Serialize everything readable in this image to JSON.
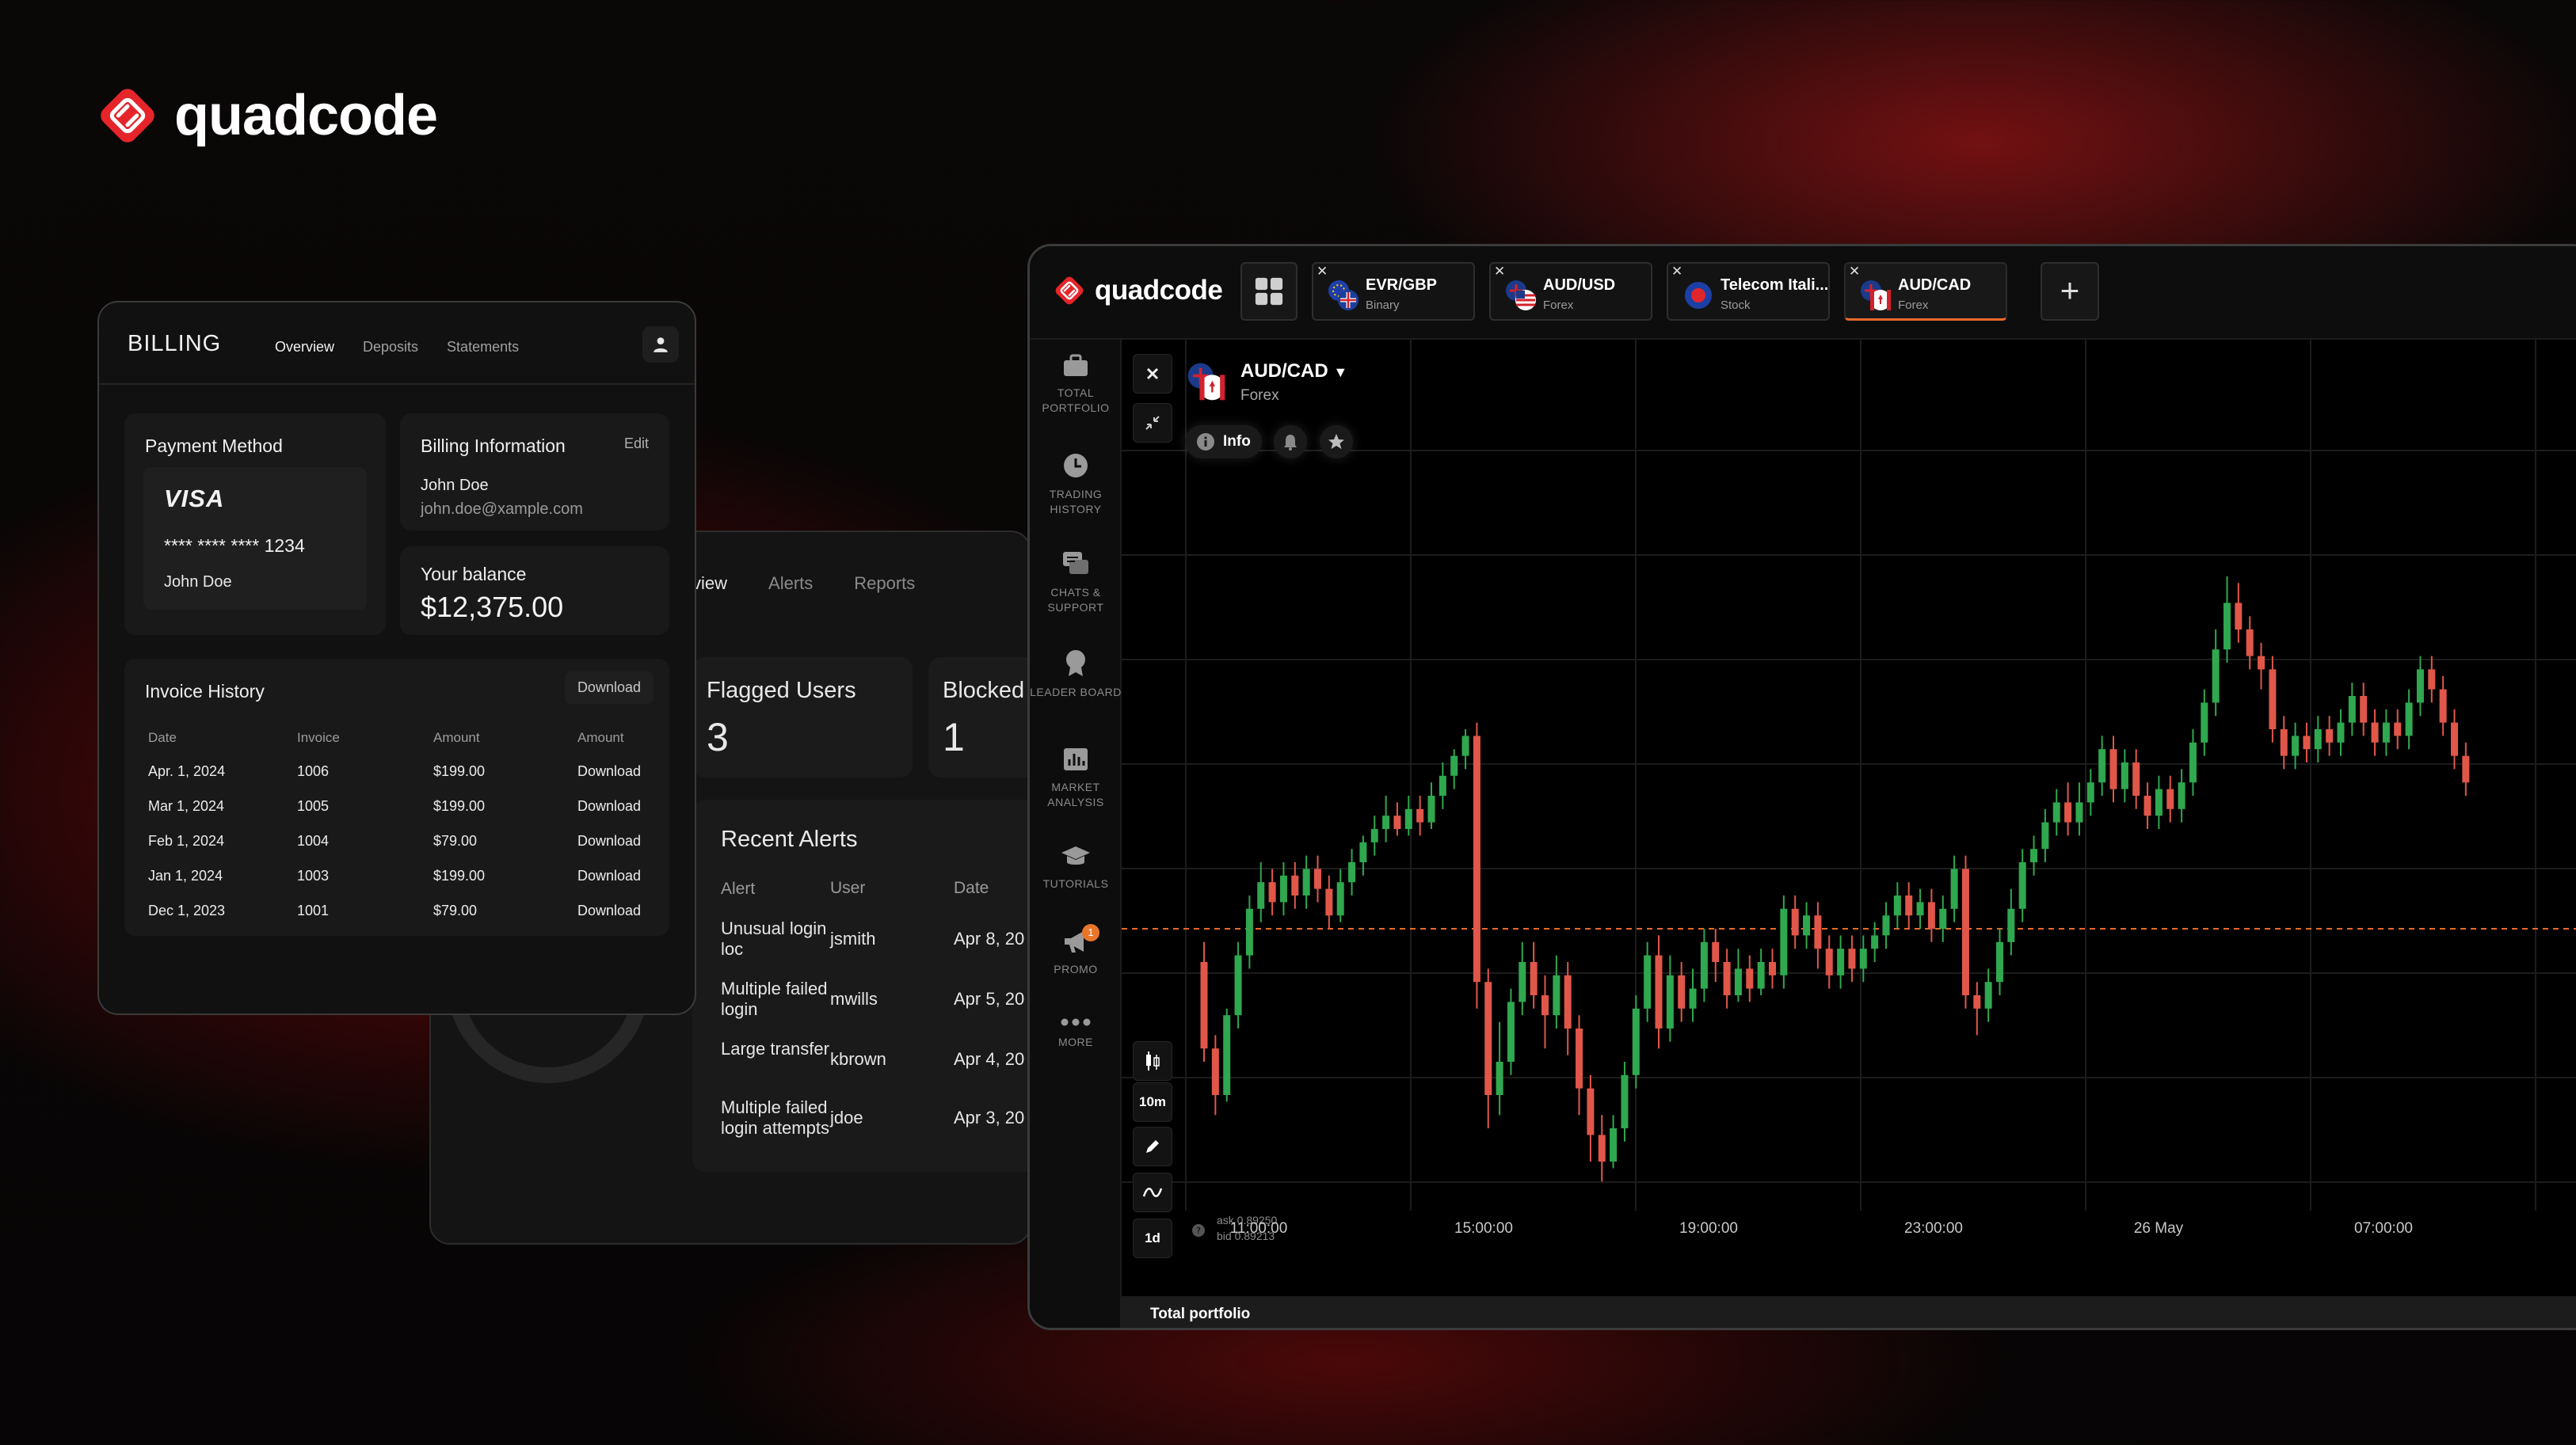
{
  "brand": {
    "name": "quadcode",
    "logo_icon": "quadcode-logo-icon"
  },
  "billing": {
    "title": "BILLING",
    "tabs": [
      "Overview",
      "Deposits",
      "Statements"
    ],
    "payment_method": {
      "title": "Payment Method",
      "card_brand": "VISA",
      "card_number": "**** **** **** 1234",
      "card_holder": "John Doe"
    },
    "billing_info": {
      "title": "Billing Information",
      "edit_label": "Edit",
      "name": "John Doe",
      "email": "john.doe@xample.com"
    },
    "balance": {
      "title": "Your balance",
      "value": "$12,375.00"
    },
    "invoice_history": {
      "title": "Invoice History",
      "download_label": "Download",
      "columns": [
        "Date",
        "Invoice",
        "Amount",
        "Amount"
      ],
      "rows": [
        {
          "date": "Apr. 1, 2024",
          "invoice": "1006",
          "amount": "$199.00",
          "action": "Download"
        },
        {
          "date": "Mar 1, 2024",
          "invoice": "1005",
          "amount": "$199.00",
          "action": "Download"
        },
        {
          "date": "Feb 1, 2024",
          "invoice": "1004",
          "amount": "$79.00",
          "action": "Download"
        },
        {
          "date": "Jan 1, 2024",
          "invoice": "1003",
          "amount": "$199.00",
          "action": "Download"
        },
        {
          "date": "Dec 1, 2023",
          "invoice": "1001",
          "amount": "$79.00",
          "action": "Download"
        }
      ]
    }
  },
  "alerts_panel": {
    "tabs": [
      "view",
      "Alerts",
      "Reports"
    ],
    "flagged": {
      "label": "Flagged Users",
      "value": "3"
    },
    "blocked": {
      "label": "Blocked",
      "value": "1"
    },
    "recent_alerts": {
      "title": "Recent Alerts",
      "columns": [
        "Alert",
        "User",
        "Date"
      ],
      "rows": [
        {
          "alert": "Unusual login loc",
          "user": "jsmith",
          "date": "Apr 8, 20"
        },
        {
          "alert": "Multiple failed login",
          "user": "mwills",
          "date": "Apr 5, 20"
        },
        {
          "alert": "Large transfer",
          "user": "kbrown",
          "date": "Apr 4, 20"
        },
        {
          "alert": "Multiple failed login attempts",
          "user": "jdoe",
          "date": "Apr 3, 20"
        }
      ]
    }
  },
  "trading": {
    "logo_text": "quadcode",
    "tabs": [
      {
        "name": "EVR/GBP",
        "type": "Binary",
        "flag": "eu-uk-flag",
        "active": false
      },
      {
        "name": "AUD/USD",
        "type": "Forex",
        "flag": "au-us-flag",
        "active": false
      },
      {
        "name": "Telecom Itali...",
        "type": "Stock",
        "flag": "telecom-logo",
        "active": false
      },
      {
        "name": "AUD/CAD",
        "type": "Forex",
        "flag": "au-ca-flag",
        "active": true
      }
    ],
    "sidebar": [
      {
        "label": "TOTAL PORTFOLIO",
        "icon": "briefcase-icon"
      },
      {
        "label": "TRADING HISTORY",
        "icon": "clock-icon"
      },
      {
        "label": "CHATS & SUPPORT",
        "icon": "chat-icon"
      },
      {
        "label": "LEADER BOARD",
        "icon": "medal-icon"
      },
      {
        "label": "MARKET ANALYSIS",
        "icon": "bar-chart-icon"
      },
      {
        "label": "TUTORIALS",
        "icon": "graduation-cap-icon"
      },
      {
        "label": "PROMO",
        "icon": "megaphone-icon",
        "badge": "1"
      },
      {
        "label": "MORE",
        "icon": "more-dots-icon"
      }
    ],
    "asset": {
      "name": "AUD/CAD",
      "type": "Forex"
    },
    "info_label": "Info",
    "timeframe": "10m",
    "period": "1d",
    "quote": {
      "ask": "ask 0.89250",
      "bid": "bid 0.89213"
    },
    "bottom_label": "Total portfolio",
    "colors": {
      "up": "#2fa84f",
      "down": "#e0574a",
      "accent": "#e86a2a"
    }
  },
  "chart_data": {
    "type": "candlestick",
    "x_labels": [
      "11:00:00",
      "15:00:00",
      "19:00:00",
      "23:00:00",
      "26 May",
      "07:00:00"
    ],
    "price_line_level": 0.4,
    "candles": [
      [
        0.35,
        0.22,
        0.38,
        0.2
      ],
      [
        0.22,
        0.15,
        0.24,
        0.12
      ],
      [
        0.15,
        0.27,
        0.28,
        0.14
      ],
      [
        0.27,
        0.36,
        0.38,
        0.25
      ],
      [
        0.36,
        0.43,
        0.45,
        0.34
      ],
      [
        0.43,
        0.47,
        0.5,
        0.41
      ],
      [
        0.47,
        0.44,
        0.49,
        0.42
      ],
      [
        0.44,
        0.48,
        0.5,
        0.42
      ],
      [
        0.48,
        0.45,
        0.5,
        0.43
      ],
      [
        0.45,
        0.49,
        0.51,
        0.43
      ],
      [
        0.49,
        0.46,
        0.51,
        0.44
      ],
      [
        0.46,
        0.42,
        0.48,
        0.4
      ],
      [
        0.42,
        0.47,
        0.49,
        0.41
      ],
      [
        0.47,
        0.5,
        0.52,
        0.45
      ],
      [
        0.5,
        0.53,
        0.54,
        0.48
      ],
      [
        0.53,
        0.55,
        0.57,
        0.51
      ],
      [
        0.55,
        0.57,
        0.6,
        0.53
      ],
      [
        0.57,
        0.55,
        0.59,
        0.54
      ],
      [
        0.55,
        0.58,
        0.6,
        0.54
      ],
      [
        0.58,
        0.56,
        0.6,
        0.54
      ],
      [
        0.56,
        0.6,
        0.62,
        0.55
      ],
      [
        0.6,
        0.63,
        0.65,
        0.58
      ],
      [
        0.63,
        0.66,
        0.67,
        0.61
      ],
      [
        0.66,
        0.69,
        0.7,
        0.64
      ],
      [
        0.69,
        0.32,
        0.71,
        0.28
      ],
      [
        0.32,
        0.15,
        0.34,
        0.1
      ],
      [
        0.15,
        0.2,
        0.26,
        0.12
      ],
      [
        0.2,
        0.29,
        0.31,
        0.18
      ],
      [
        0.29,
        0.35,
        0.38,
        0.27
      ],
      [
        0.35,
        0.3,
        0.38,
        0.28
      ],
      [
        0.3,
        0.27,
        0.33,
        0.22
      ],
      [
        0.27,
        0.33,
        0.36,
        0.25
      ],
      [
        0.33,
        0.25,
        0.35,
        0.21
      ],
      [
        0.25,
        0.16,
        0.27,
        0.12
      ],
      [
        0.16,
        0.09,
        0.18,
        0.05
      ],
      [
        0.09,
        0.05,
        0.12,
        0.02
      ],
      [
        0.05,
        0.1,
        0.12,
        0.04
      ],
      [
        0.1,
        0.18,
        0.2,
        0.08
      ],
      [
        0.18,
        0.28,
        0.3,
        0.16
      ],
      [
        0.28,
        0.36,
        0.38,
        0.26
      ],
      [
        0.36,
        0.25,
        0.39,
        0.22
      ],
      [
        0.25,
        0.33,
        0.36,
        0.23
      ],
      [
        0.33,
        0.28,
        0.35,
        0.26
      ],
      [
        0.28,
        0.31,
        0.34,
        0.26
      ],
      [
        0.31,
        0.38,
        0.4,
        0.29
      ],
      [
        0.38,
        0.35,
        0.4,
        0.32
      ],
      [
        0.35,
        0.3,
        0.37,
        0.28
      ],
      [
        0.3,
        0.34,
        0.37,
        0.29
      ],
      [
        0.34,
        0.31,
        0.36,
        0.29
      ],
      [
        0.31,
        0.35,
        0.37,
        0.3
      ],
      [
        0.35,
        0.33,
        0.37,
        0.31
      ],
      [
        0.33,
        0.43,
        0.45,
        0.31
      ],
      [
        0.43,
        0.39,
        0.45,
        0.37
      ],
      [
        0.39,
        0.42,
        0.44,
        0.37
      ],
      [
        0.42,
        0.37,
        0.44,
        0.34
      ],
      [
        0.37,
        0.33,
        0.39,
        0.31
      ],
      [
        0.33,
        0.37,
        0.39,
        0.31
      ],
      [
        0.37,
        0.34,
        0.39,
        0.32
      ],
      [
        0.34,
        0.37,
        0.39,
        0.32
      ],
      [
        0.37,
        0.39,
        0.41,
        0.35
      ],
      [
        0.39,
        0.42,
        0.44,
        0.37
      ],
      [
        0.42,
        0.45,
        0.47,
        0.4
      ],
      [
        0.45,
        0.42,
        0.47,
        0.4
      ],
      [
        0.42,
        0.44,
        0.46,
        0.4
      ],
      [
        0.44,
        0.4,
        0.46,
        0.38
      ],
      [
        0.4,
        0.43,
        0.45,
        0.38
      ],
      [
        0.43,
        0.49,
        0.51,
        0.41
      ],
      [
        0.49,
        0.3,
        0.51,
        0.28
      ],
      [
        0.3,
        0.28,
        0.32,
        0.24
      ],
      [
        0.28,
        0.32,
        0.34,
        0.26
      ],
      [
        0.32,
        0.38,
        0.4,
        0.3
      ],
      [
        0.38,
        0.43,
        0.46,
        0.36
      ],
      [
        0.43,
        0.5,
        0.52,
        0.41
      ],
      [
        0.5,
        0.52,
        0.54,
        0.48
      ],
      [
        0.52,
        0.56,
        0.58,
        0.5
      ],
      [
        0.56,
        0.59,
        0.61,
        0.54
      ],
      [
        0.59,
        0.56,
        0.62,
        0.54
      ],
      [
        0.56,
        0.59,
        0.62,
        0.54
      ],
      [
        0.59,
        0.62,
        0.64,
        0.57
      ],
      [
        0.62,
        0.67,
        0.69,
        0.6
      ],
      [
        0.67,
        0.61,
        0.69,
        0.59
      ],
      [
        0.61,
        0.65,
        0.67,
        0.59
      ],
      [
        0.65,
        0.6,
        0.67,
        0.58
      ],
      [
        0.6,
        0.57,
        0.62,
        0.55
      ],
      [
        0.57,
        0.61,
        0.63,
        0.55
      ],
      [
        0.61,
        0.58,
        0.63,
        0.56
      ],
      [
        0.58,
        0.62,
        0.64,
        0.56
      ],
      [
        0.62,
        0.68,
        0.7,
        0.6
      ],
      [
        0.68,
        0.74,
        0.76,
        0.66
      ],
      [
        0.74,
        0.82,
        0.85,
        0.72
      ],
      [
        0.82,
        0.89,
        0.93,
        0.8
      ],
      [
        0.89,
        0.85,
        0.92,
        0.83
      ],
      [
        0.85,
        0.81,
        0.87,
        0.79
      ],
      [
        0.81,
        0.79,
        0.83,
        0.76
      ],
      [
        0.79,
        0.7,
        0.81,
        0.68
      ],
      [
        0.7,
        0.66,
        0.72,
        0.64
      ],
      [
        0.66,
        0.69,
        0.71,
        0.64
      ],
      [
        0.69,
        0.67,
        0.71,
        0.65
      ],
      [
        0.67,
        0.7,
        0.72,
        0.65
      ],
      [
        0.7,
        0.68,
        0.72,
        0.66
      ],
      [
        0.68,
        0.71,
        0.73,
        0.66
      ],
      [
        0.71,
        0.75,
        0.77,
        0.69
      ],
      [
        0.75,
        0.71,
        0.77,
        0.69
      ],
      [
        0.71,
        0.68,
        0.73,
        0.66
      ],
      [
        0.68,
        0.71,
        0.73,
        0.66
      ],
      [
        0.71,
        0.69,
        0.73,
        0.67
      ],
      [
        0.69,
        0.74,
        0.76,
        0.67
      ],
      [
        0.74,
        0.79,
        0.81,
        0.72
      ],
      [
        0.79,
        0.76,
        0.81,
        0.74
      ],
      [
        0.76,
        0.71,
        0.78,
        0.69
      ],
      [
        0.71,
        0.66,
        0.73,
        0.64
      ],
      [
        0.66,
        0.62,
        0.68,
        0.6
      ]
    ]
  }
}
